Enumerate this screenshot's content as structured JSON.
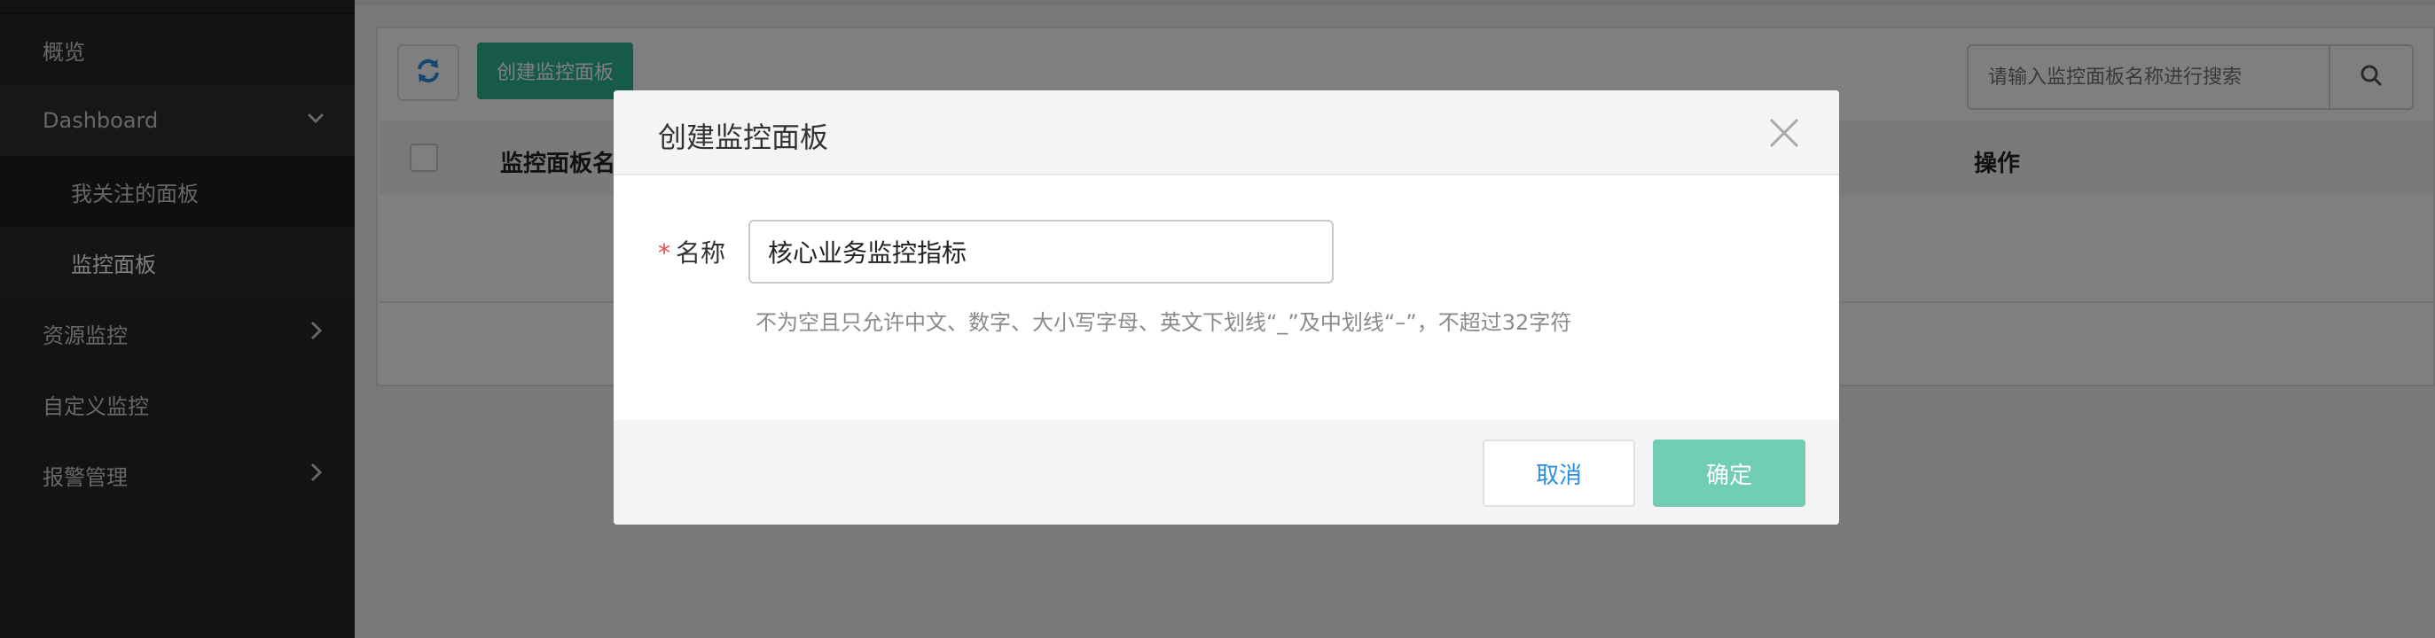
{
  "sidebar": {
    "items": [
      {
        "label": "概览"
      },
      {
        "label": "Dashboard"
      },
      {
        "label": "我关注的面板"
      },
      {
        "label": "监控面板"
      },
      {
        "label": "资源监控"
      },
      {
        "label": "自定义监控"
      },
      {
        "label": "报警管理"
      }
    ]
  },
  "toolbar": {
    "refresh_icon": "refresh-icon",
    "create_label": "创建监控面板",
    "search_placeholder": "请输入监控面板名称进行搜索",
    "search_icon": "search-icon"
  },
  "table": {
    "columns": [
      "监控面板名",
      "操作"
    ]
  },
  "modal": {
    "title": "创建监控面板",
    "name_label": "名称",
    "required_mark": "*",
    "name_value": "核心业务监控指标",
    "hint": "不为空且只允许中文、数字、大小写字母、英文下划线“_”及中划线“–”，不超过32字符",
    "cancel_label": "取消",
    "ok_label": "确定"
  },
  "colors": {
    "sidebar_bg": "#262626",
    "primary": "#2fb592",
    "primary_disabled": "#72cdb5",
    "link_blue": "#2a8ee6",
    "required_red": "#e14b4b"
  }
}
